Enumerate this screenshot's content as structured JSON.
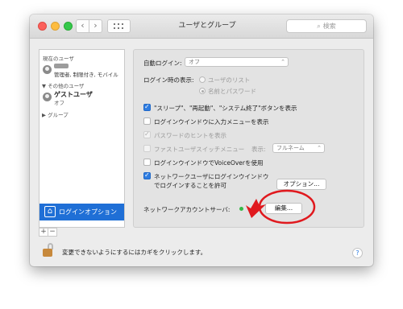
{
  "window": {
    "title": "ユーザとグループ",
    "search_placeholder": "検索",
    "nav_back": "‹",
    "nav_forward": "›"
  },
  "sidebar": {
    "current_user_header": "現在のユーザ",
    "current_user_role": "管理者, 制限付き, モバイル",
    "other_users_header": "▼ その他のユーザ",
    "guest_name": "ゲストユーザ",
    "guest_status": "オフ",
    "groups_label": "▶ グループ",
    "login_options_label": "ログインオプション",
    "add_label": "+",
    "remove_label": "−"
  },
  "panel": {
    "auto_login_label": "自動ログイン:",
    "auto_login_value": "オフ",
    "login_display_label": "ログイン時の表示:",
    "radio_user_list": "ユーザのリスト",
    "radio_name_password": "名前とパスワード",
    "checkbox_sleep_buttons": "\"スリープ\"、\"再起動\"、\"システム終了\"ボタンを表示",
    "checkbox_input_menu": "ログインウインドウに入力メニューを表示",
    "checkbox_password_hints": "パスワードのヒントを表示",
    "checkbox_fast_user_switch": "ファストユーザスイッチメニュー",
    "display_label": "表示:",
    "display_value": "フルネーム",
    "checkbox_voiceover": "ログインウインドウでVoiceOverを使用",
    "checkbox_network_users_line1": "ネットワークユーザにログインウインドウ",
    "checkbox_network_users_line2": "でログインすることを許可",
    "options_button": "オプション...",
    "network_account_server_label": "ネットワークアカウントサーバ:",
    "edit_button": "編集..."
  },
  "footer": {
    "lock_text": "変更できないようにするにはカギをクリックします。",
    "help_label": "?"
  },
  "colors": {
    "selection_blue": "#1f6fd6",
    "annotation_red": "#e0191e",
    "checkbox_blue": "#2f7de1"
  }
}
